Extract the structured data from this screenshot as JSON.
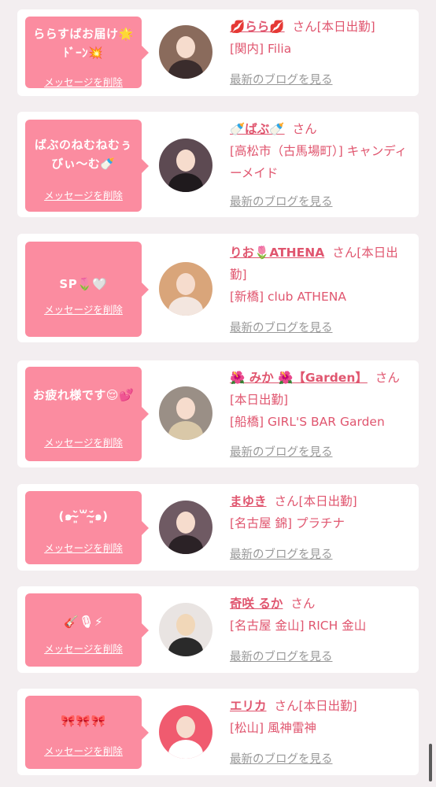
{
  "delete_label": "メッセージを削除",
  "blog_label": "最新のブログを見る",
  "san": "さん",
  "cards": [
    {
      "message": "ららすばお届け🌟ﾄﾞｰﾝ💥",
      "name": "💋らら💋",
      "status": "[本日出勤]",
      "shop": "[関内] Filia",
      "avatar_color": "#8a6b5c"
    },
    {
      "message": "ばぶのねむねむぅびぃ〜む🍼",
      "name": "🍼ばぶ🍼",
      "status": "",
      "shop": "[高松市（古馬場町）] キャンディーメイド",
      "avatar_color": "#5d4a52"
    },
    {
      "message": "SP🌷🤍",
      "name": "りお🌷ATHENA",
      "status": "[本日出勤]",
      "shop": "[新橋] club ATHENA",
      "avatar_color": "#d9a57a"
    },
    {
      "message": "お疲れ様です😌💕",
      "name": "🌺 みか 🌺【Garden】",
      "status": "[本日出勤]",
      "shop": "[船橋] GIRL'S BAR Garden",
      "avatar_color": "#9a8f86"
    },
    {
      "message": "(๑˘̴͈̀꒳˘̴͈́๑)",
      "name": "まゆき",
      "status": "[本日出勤]",
      "shop": "[名古屋 錦] プラチナ",
      "avatar_color": "#6f5a63"
    },
    {
      "message": "🎸🎙⚡",
      "name": "奇咲 るか",
      "status": "",
      "shop": "[名古屋 金山] RICH 金山",
      "avatar_color": "#e9e4e2"
    },
    {
      "message": "🎀🎀🎀",
      "name": "エリカ",
      "status": "[本日出勤]",
      "shop": "[松山] 風神雷神",
      "avatar_color": "#f05b6f"
    }
  ],
  "colors": {
    "background": "#f3eef0",
    "bubble": "#fb8ca0",
    "accent_text": "#e0566f",
    "muted_link": "#999999"
  }
}
